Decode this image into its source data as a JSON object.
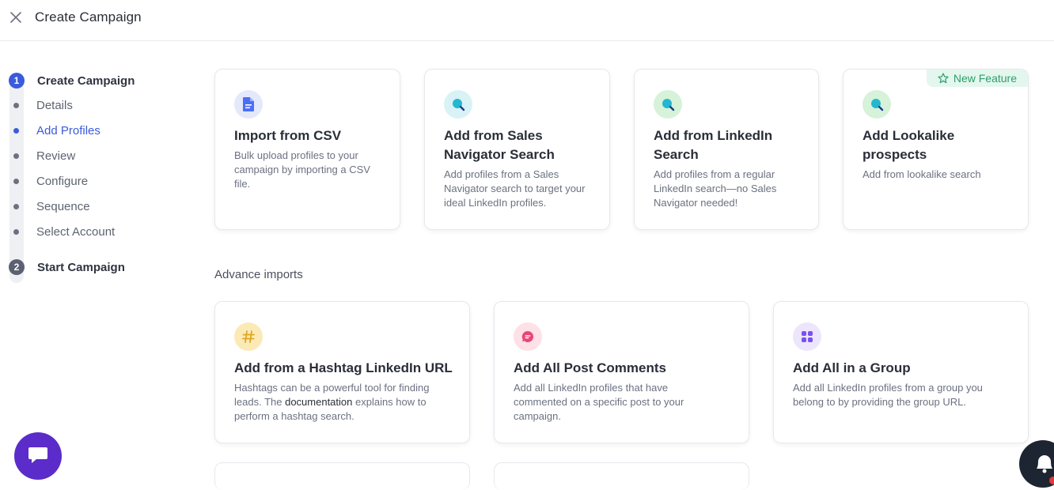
{
  "header": {
    "title": "Create Campaign",
    "close_icon": "close-icon"
  },
  "stepper": {
    "step1": {
      "number": "1",
      "label": "Create Campaign"
    },
    "items": [
      {
        "label": "Details",
        "active": false
      },
      {
        "label": "Add Profiles",
        "active": true
      },
      {
        "label": "Review",
        "active": false
      },
      {
        "label": "Configure",
        "active": false
      },
      {
        "label": "Sequence",
        "active": false
      },
      {
        "label": "Select Account",
        "active": false
      }
    ],
    "step2": {
      "number": "2",
      "label": "Start Campaign"
    }
  },
  "import_cards": [
    {
      "title": "Import from CSV",
      "description": "Bulk upload profiles to your campaign by importing a CSV file.",
      "icon": "file-icon"
    },
    {
      "title": "Add from Sales Navigator Search",
      "description": "Add profiles from a Sales Navigator search to target your ideal LinkedIn profiles.",
      "icon": "search-icon"
    },
    {
      "title": "Add from LinkedIn Search",
      "description": "Add profiles from a regular LinkedIn search—no Sales Navigator needed!",
      "icon": "search-icon"
    },
    {
      "title": "Add Lookalike prospects",
      "description": "Add from lookalike search",
      "icon": "search-icon",
      "badge": "New Feature"
    }
  ],
  "advance": {
    "heading": "Advance imports",
    "cards": [
      {
        "title": "Add from a Hashtag LinkedIn URL",
        "desc_before": "Hashtags can be a powerful tool for finding leads. The ",
        "desc_link": "documentation",
        "desc_after": " explains how to perform a hashtag search.",
        "icon": "hashtag-icon"
      },
      {
        "title": "Add All Post Comments",
        "description": "Add all LinkedIn profiles that have commented on a specific post to your campaign.",
        "icon": "comment-icon"
      },
      {
        "title": "Add All in a Group",
        "description": "Add all LinkedIn profiles from a group you belong to by providing the group URL.",
        "icon": "group-grid-icon"
      }
    ]
  },
  "colors": {
    "accent": "#3b5bdb",
    "badge_bg": "#e3f7ee",
    "badge_text": "#2f9e6a",
    "chat_fab": "#5b2cc9",
    "bell_fab": "#1d2533"
  },
  "floating": {
    "chat_icon": "chat-icon",
    "bell_icon": "bell-icon"
  }
}
